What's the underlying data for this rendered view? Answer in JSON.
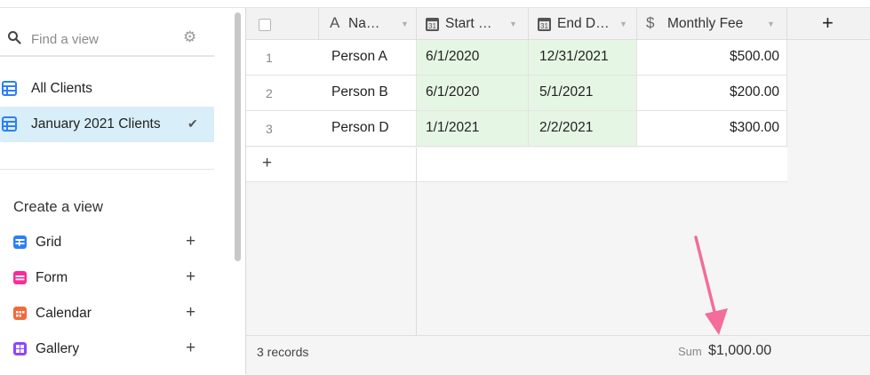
{
  "sidebar": {
    "search_placeholder": "Find a view",
    "views": [
      {
        "label": "All Clients",
        "icon": "grid-icon",
        "active": false
      },
      {
        "label": "January 2021 Clients",
        "icon": "grid-icon",
        "active": true
      }
    ],
    "create_title": "Create a view",
    "create_items": [
      {
        "label": "Grid",
        "icon": "grid-view-icon",
        "color": "#2d7ff9"
      },
      {
        "label": "Form",
        "icon": "form-view-icon",
        "color": "#f82b9a"
      },
      {
        "label": "Calendar",
        "icon": "calendar-view-icon",
        "color": "#f06a3a"
      },
      {
        "label": "Gallery",
        "icon": "gallery-view-icon",
        "color": "#8b46ff"
      }
    ],
    "plus": "+",
    "check": "✔"
  },
  "grid": {
    "columns": [
      {
        "label": "Na…",
        "icon": "text-field-icon"
      },
      {
        "label": "Start …",
        "icon": "date-field-icon"
      },
      {
        "label": "End D…",
        "icon": "date-field-icon"
      },
      {
        "label": "Monthly Fee",
        "icon": "currency-field-icon"
      }
    ],
    "add_column": "+",
    "rows": [
      {
        "num": "1",
        "name": "Person A",
        "start": "6/1/2020",
        "end": "12/31/2021",
        "fee": "$500.00"
      },
      {
        "num": "2",
        "name": "Person B",
        "start": "6/1/2020",
        "end": "5/1/2021",
        "fee": "$200.00"
      },
      {
        "num": "3",
        "name": "Person D",
        "start": "1/1/2021",
        "end": "2/2/2021",
        "fee": "$300.00"
      }
    ],
    "add_row": "+"
  },
  "footer": {
    "records": "3 records",
    "sum_label": "Sum",
    "sum_value": "$1,000.00"
  },
  "colors": {
    "active_view": "#d8eef9",
    "date_cell": "#e6f6e4",
    "annotation_arrow": "#f36c9b"
  }
}
